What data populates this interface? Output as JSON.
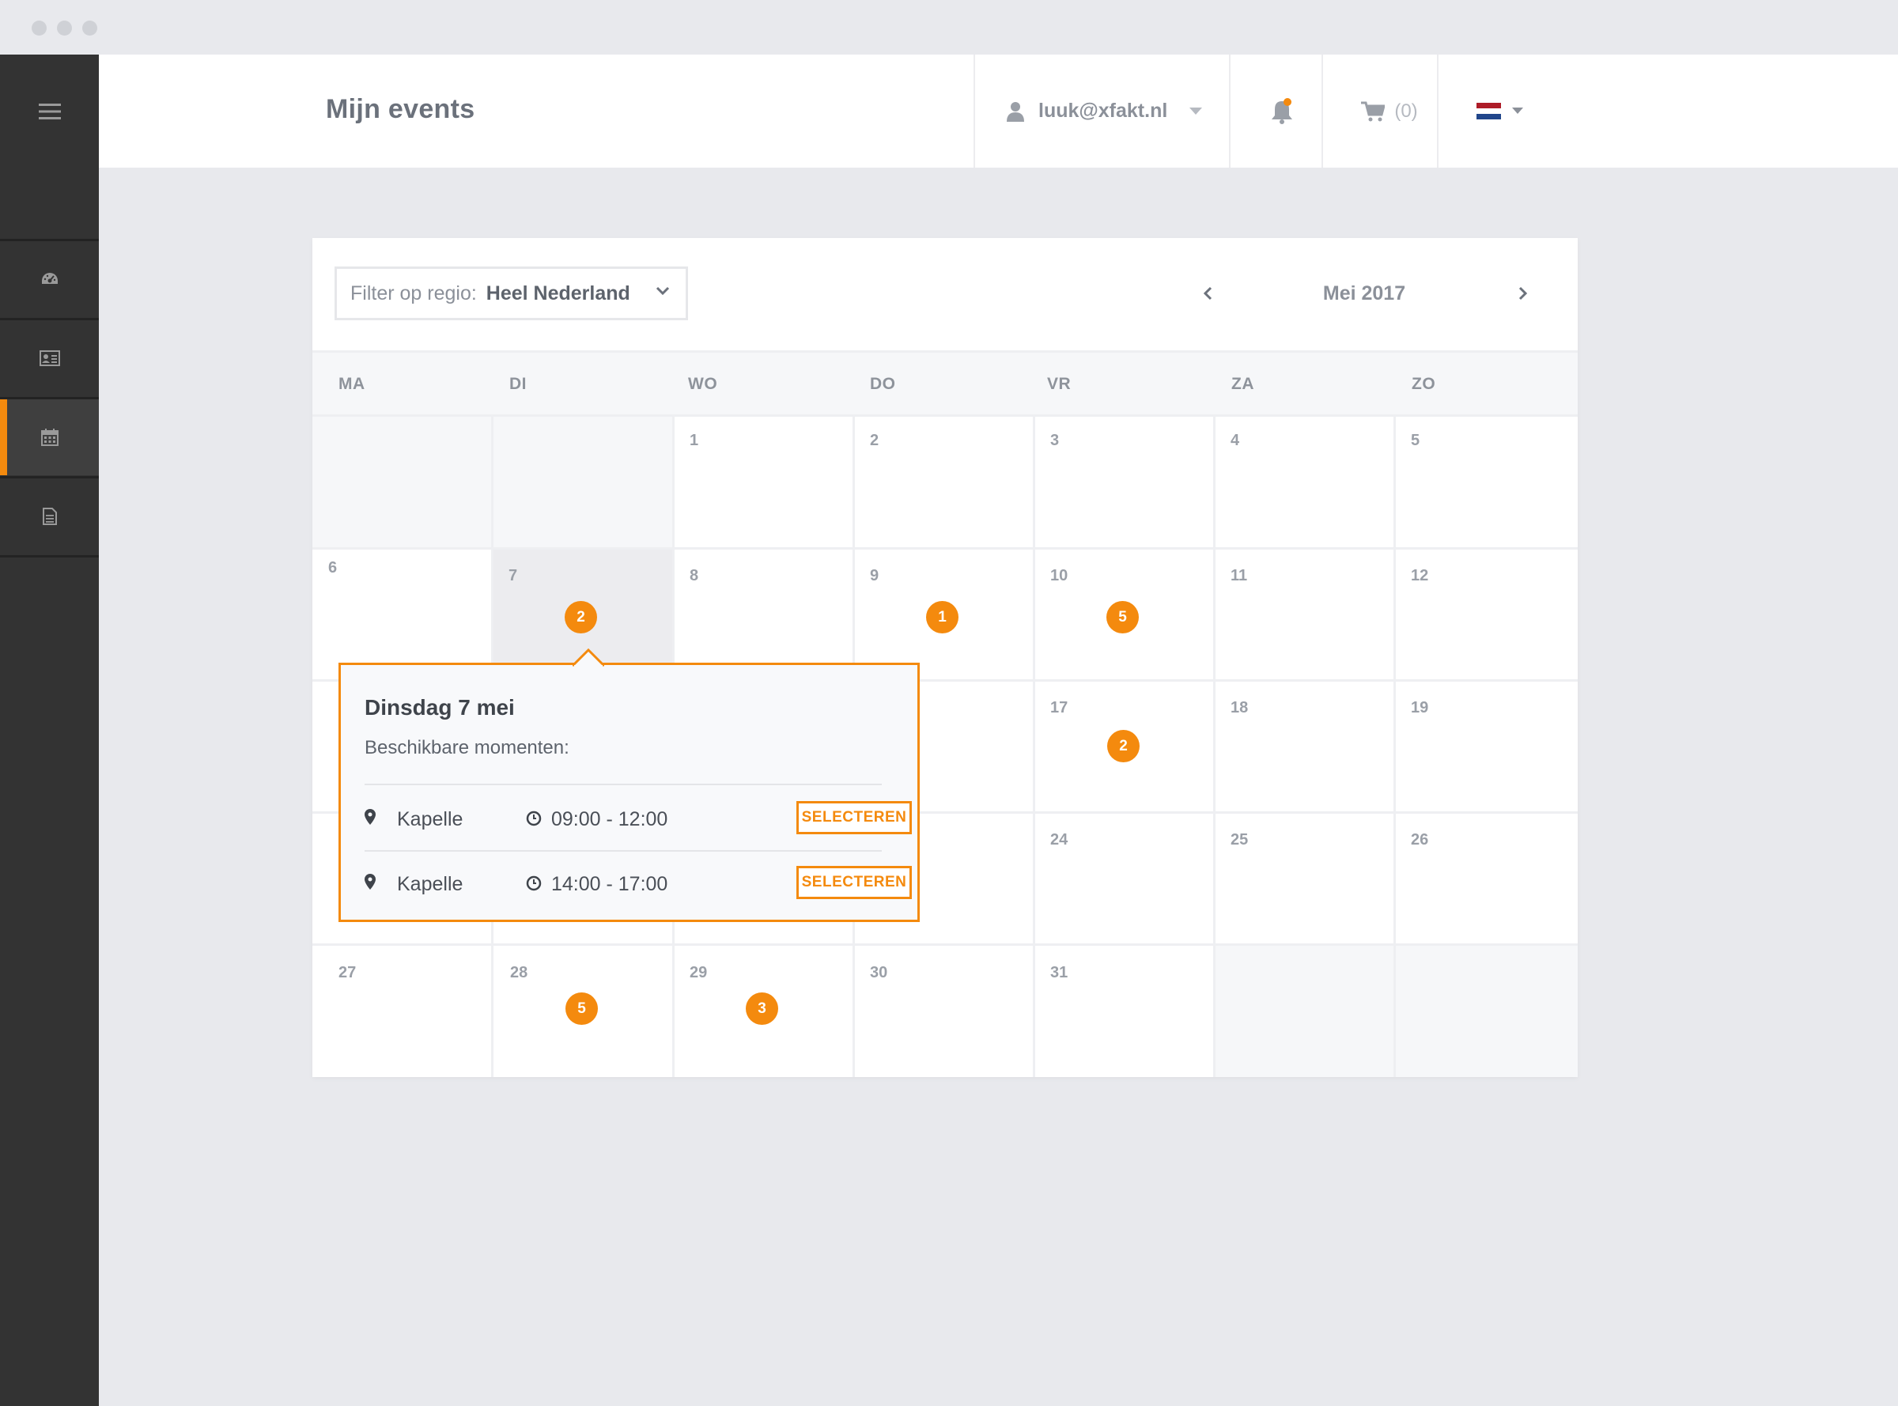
{
  "header": {
    "title": "Mijn events",
    "user_email": "luuk@xfakt.nl",
    "cart_count": "(0)"
  },
  "sidebar": {
    "items": [
      {
        "icon": "dashboard-icon"
      },
      {
        "icon": "contact-card-icon"
      },
      {
        "icon": "calendar-icon",
        "active": true
      },
      {
        "icon": "document-icon"
      }
    ]
  },
  "filter": {
    "label": "Filter op regio:",
    "value": "Heel Nederland"
  },
  "calendar": {
    "month": "Mei 2017",
    "weekdays": [
      "MA",
      "DI",
      "WO",
      "DO",
      "VR",
      "ZA",
      "ZO"
    ],
    "days": {
      "d1": "1",
      "d2": "2",
      "d3": "3",
      "d4": "4",
      "d5": "5",
      "d6": "6",
      "d7": "7",
      "d8": "8",
      "d9": "9",
      "d10": "10",
      "d11": "11",
      "d12": "12",
      "d17": "17",
      "d18": "18",
      "d19": "19",
      "d24": "24",
      "d25": "25",
      "d26": "26",
      "d27": "27",
      "d28": "28",
      "d29": "29",
      "d30": "30",
      "d31": "31"
    },
    "badges": {
      "d7": "2",
      "d9": "1",
      "d10": "5",
      "d17": "2",
      "d28": "5",
      "d29": "3"
    }
  },
  "popover": {
    "title": "Dinsdag 7 mei",
    "subtitle": "Beschikbare momenten:",
    "slots": [
      {
        "location": "Kapelle",
        "time": "09:00 - 12:00",
        "button": "SELECTEREN"
      },
      {
        "location": "Kapelle",
        "time": "14:00 - 17:00",
        "button": "SELECTEREN"
      }
    ]
  },
  "colors": {
    "accent": "#f48a0e",
    "sidebar": "#333333",
    "background": "#e8e9ed"
  }
}
